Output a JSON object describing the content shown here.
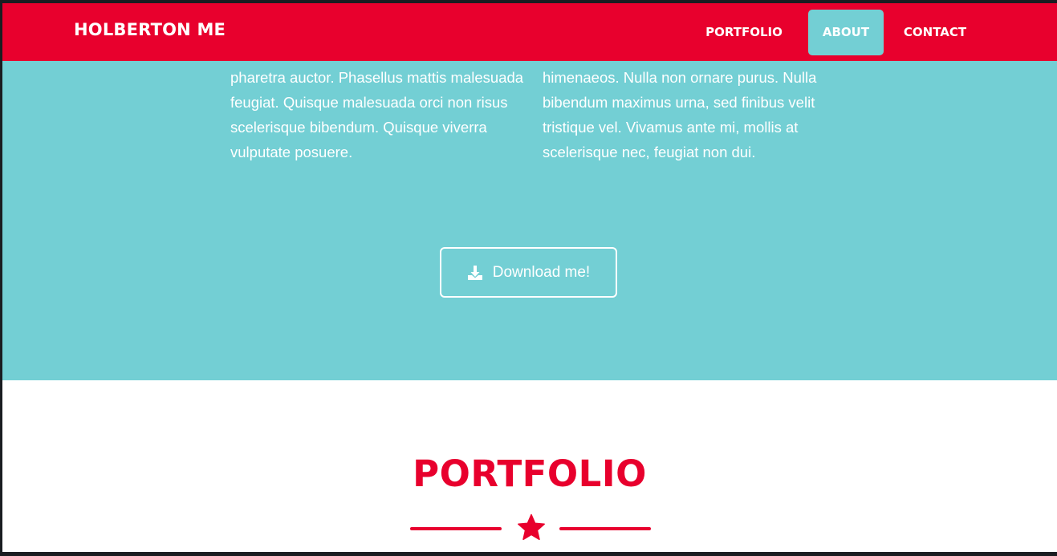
{
  "navbar": {
    "brand": "HOLBERTON ME",
    "items": [
      {
        "label": "PORTFOLIO",
        "active": false
      },
      {
        "label": "ABOUT",
        "active": true
      },
      {
        "label": "CONTACT",
        "active": false
      }
    ]
  },
  "about": {
    "left_text": "adipiscing elit. Nam blandit turpis iaculis nisl pharetra auctor. Phasellus mattis malesuada feugiat. Quisque malesuada orci non risus scelerisque bibendum. Quisque viverra vulputate posuere.",
    "right_text": "torquent per conubia nostra, per inceptos himenaeos. Nulla non ornare purus. Nulla bibendum maximus urna, sed finibus velit tristique vel. Vivamus ante mi, mollis at scelerisque nec, feugiat non dui.",
    "download_button": {
      "label": "Download me!",
      "icon": "download-icon"
    }
  },
  "portfolio": {
    "title": "PORTFOLIO",
    "divider_icon": "star-icon"
  },
  "colors": {
    "primary_red": "#e8002d",
    "teal": "#73cfd4",
    "white": "#ffffff"
  }
}
